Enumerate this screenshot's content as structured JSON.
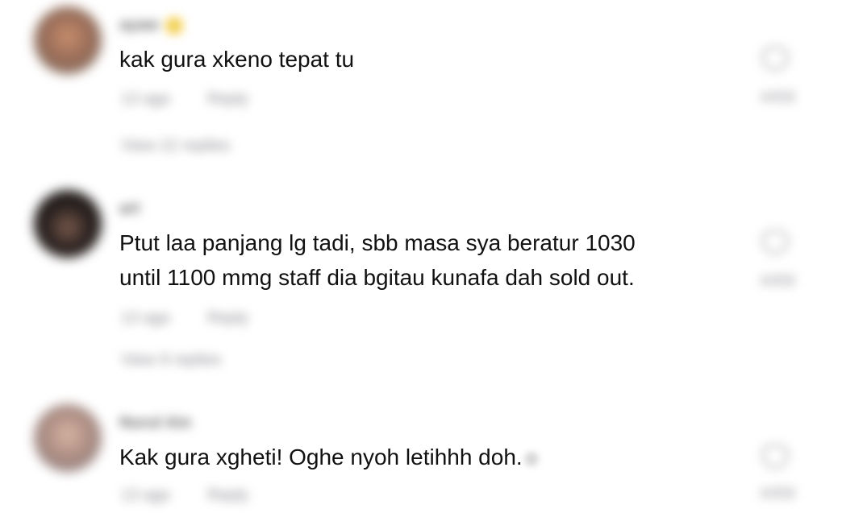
{
  "comments": [
    {
      "username": "ayaw",
      "text": "kak gura xkeno tepat tu",
      "time": "13 ago",
      "reply_label": "Reply",
      "view_replies": "View 22 replies",
      "like_count": "4456"
    },
    {
      "username": "art",
      "text_line1": "Ptut laa panjang lg tadi, sbb masa sya beratur 1030",
      "text_line2": "until 1100 mmg staff dia bgitau kunafa dah sold out.",
      "time": "13 ago",
      "reply_label": "Reply",
      "view_replies": "View 9 replies",
      "like_count": "4456"
    },
    {
      "username": "Nurul Ain",
      "text": "Kak gura xgheti! Oghe nyoh letihhh doh.",
      "time": "13 ago",
      "reply_label": "Reply",
      "like_count": "4456"
    }
  ]
}
